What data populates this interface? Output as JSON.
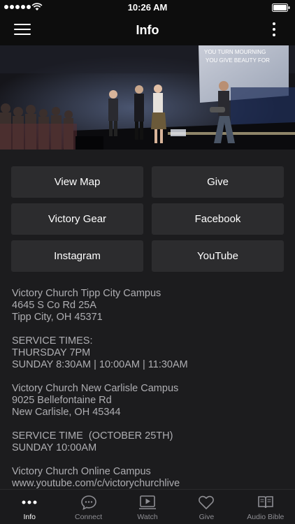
{
  "status_bar": {
    "time": "10:26 AM"
  },
  "nav": {
    "title": "Info"
  },
  "hero": {
    "screen_text_1": "YOU TURN MOURNING",
    "screen_text_2": "YOU GIVE BEAUTY FOR"
  },
  "buttons": [
    {
      "label": "View Map"
    },
    {
      "label": "Give"
    },
    {
      "label": "Victory Gear"
    },
    {
      "label": "Facebook"
    },
    {
      "label": "Instagram"
    },
    {
      "label": "YouTube"
    }
  ],
  "info": {
    "tipp_campus": {
      "name": "Victory Church Tipp City Campus",
      "street": "4645 S Co Rd 25A",
      "city": "Tipp City, OH 45371"
    },
    "tipp_service": {
      "heading": "SERVICE TIMES:",
      "line1": "THURSDAY 7PM",
      "line2": "SUNDAY 8:30AM | 10:00AM | 11:30AM"
    },
    "carlisle_campus": {
      "name": "Victory Church New Carlisle Campus",
      "street": "9025 Bellefontaine Rd",
      "city": "New Carlisle, OH 45344"
    },
    "carlisle_service": {
      "heading": "SERVICE TIME  (OCTOBER 25TH)",
      "line1": "SUNDAY 10:00AM"
    },
    "online_campus": {
      "name": "Victory Church Online Campus",
      "url": "www.youtube.com/c/victorychurchlive"
    }
  },
  "tabs": [
    {
      "label": "Info",
      "icon": "more-dots-icon"
    },
    {
      "label": "Connect",
      "icon": "chat-bubble-icon"
    },
    {
      "label": "Watch",
      "icon": "video-play-icon"
    },
    {
      "label": "Give",
      "icon": "heart-icon"
    },
    {
      "label": "Audio Bible",
      "icon": "book-icon"
    }
  ],
  "colors": {
    "background": "#1c1c1e",
    "button": "#2c2c2e",
    "bar": "#0d0d0d",
    "text_muted": "#aeaeb2",
    "tab_inactive": "#8e8e93"
  }
}
